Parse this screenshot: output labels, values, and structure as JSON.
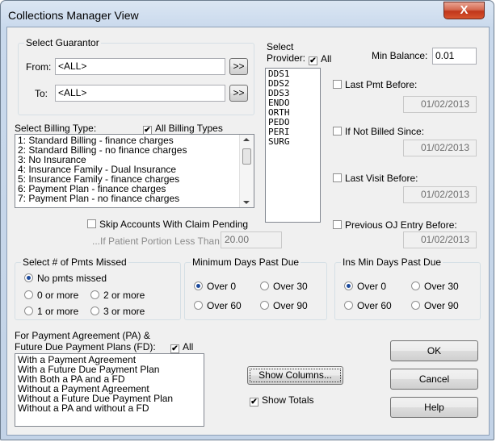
{
  "window": {
    "title": "Collections Manager View",
    "close_glyph": "X"
  },
  "guarantor": {
    "group_label": "Select Guarantor",
    "from_label": "From:",
    "from_value": "<ALL>",
    "to_label": "To:",
    "to_value": "<ALL>",
    "browse_label": ">>"
  },
  "provider": {
    "select_label": "Select",
    "provider_label": "Provider:",
    "all_label": "All",
    "all_checked": true,
    "items": [
      "DDS1",
      "DDS2",
      "DDS3",
      "ENDO",
      "ORTH",
      "PEDO",
      "PERI",
      "SURG"
    ]
  },
  "min_balance": {
    "label": "Min Balance:",
    "value": "0.01"
  },
  "billing": {
    "label": "Select Billing Type:",
    "all_label": "All Billing Types",
    "all_checked": true,
    "items": [
      "1: Standard Billing - finance charges",
      "2: Standard Billing - no finance charges",
      "3: No Insurance",
      "4: Insurance Family - Dual Insurance",
      "5: Insurance Family - finance charges",
      "6: Payment Plan - finance charges",
      "7: Payment Plan - no finance charges"
    ]
  },
  "filters": {
    "last_pmt": {
      "label": "Last Pmt Before:",
      "date": "01/02/2013",
      "checked": false
    },
    "not_billed": {
      "label": "If Not Billed Since:",
      "date": "01/02/2013",
      "checked": false
    },
    "last_visit": {
      "label": "Last Visit Before:",
      "date": "01/02/2013",
      "checked": false
    },
    "prev_oj": {
      "label": "Previous OJ Entry Before:",
      "date": "01/02/2013",
      "checked": false
    }
  },
  "claim": {
    "skip_label": "Skip Accounts With Claim Pending",
    "skip_checked": false,
    "portion_label": "...If Patient Portion Less Than:",
    "portion_value": "20.00"
  },
  "pmts_missed": {
    "group_label": "Select # of Pmts Missed",
    "options": [
      "No pmts missed",
      "0 or more",
      "2 or more",
      "1 or more",
      "3 or more"
    ],
    "selected": "No pmts missed"
  },
  "min_days": {
    "group_label": "Minimum Days Past Due",
    "options": [
      "Over 0",
      "Over 30",
      "Over 60",
      "Over 90"
    ],
    "selected": "Over 0"
  },
  "ins_days": {
    "group_label": "Ins Min Days Past Due",
    "options": [
      "Over 0",
      "Over 30",
      "Over 60",
      "Over 90"
    ],
    "selected": "Over 0"
  },
  "payment_agreement": {
    "label_line1": "For Payment Agreement (PA) &",
    "label_line2": "Future Due Payment Plans (FD):",
    "all_label": "All",
    "all_checked": true,
    "items": [
      "With a Payment Agreement",
      "With a Future Due Payment Plan",
      "With Both a PA and a FD",
      "Without a Payment Agreement",
      "Without a Future Due Payment Plan",
      "Without a PA and without a FD"
    ]
  },
  "buttons": {
    "show_columns": "Show Columns...",
    "show_totals": "Show Totals",
    "show_totals_checked": true,
    "ok": "OK",
    "cancel": "Cancel",
    "help": "Help"
  },
  "icons": {
    "checkbox_checked": "checkmark-glyph",
    "close": "close-x-glyph"
  }
}
